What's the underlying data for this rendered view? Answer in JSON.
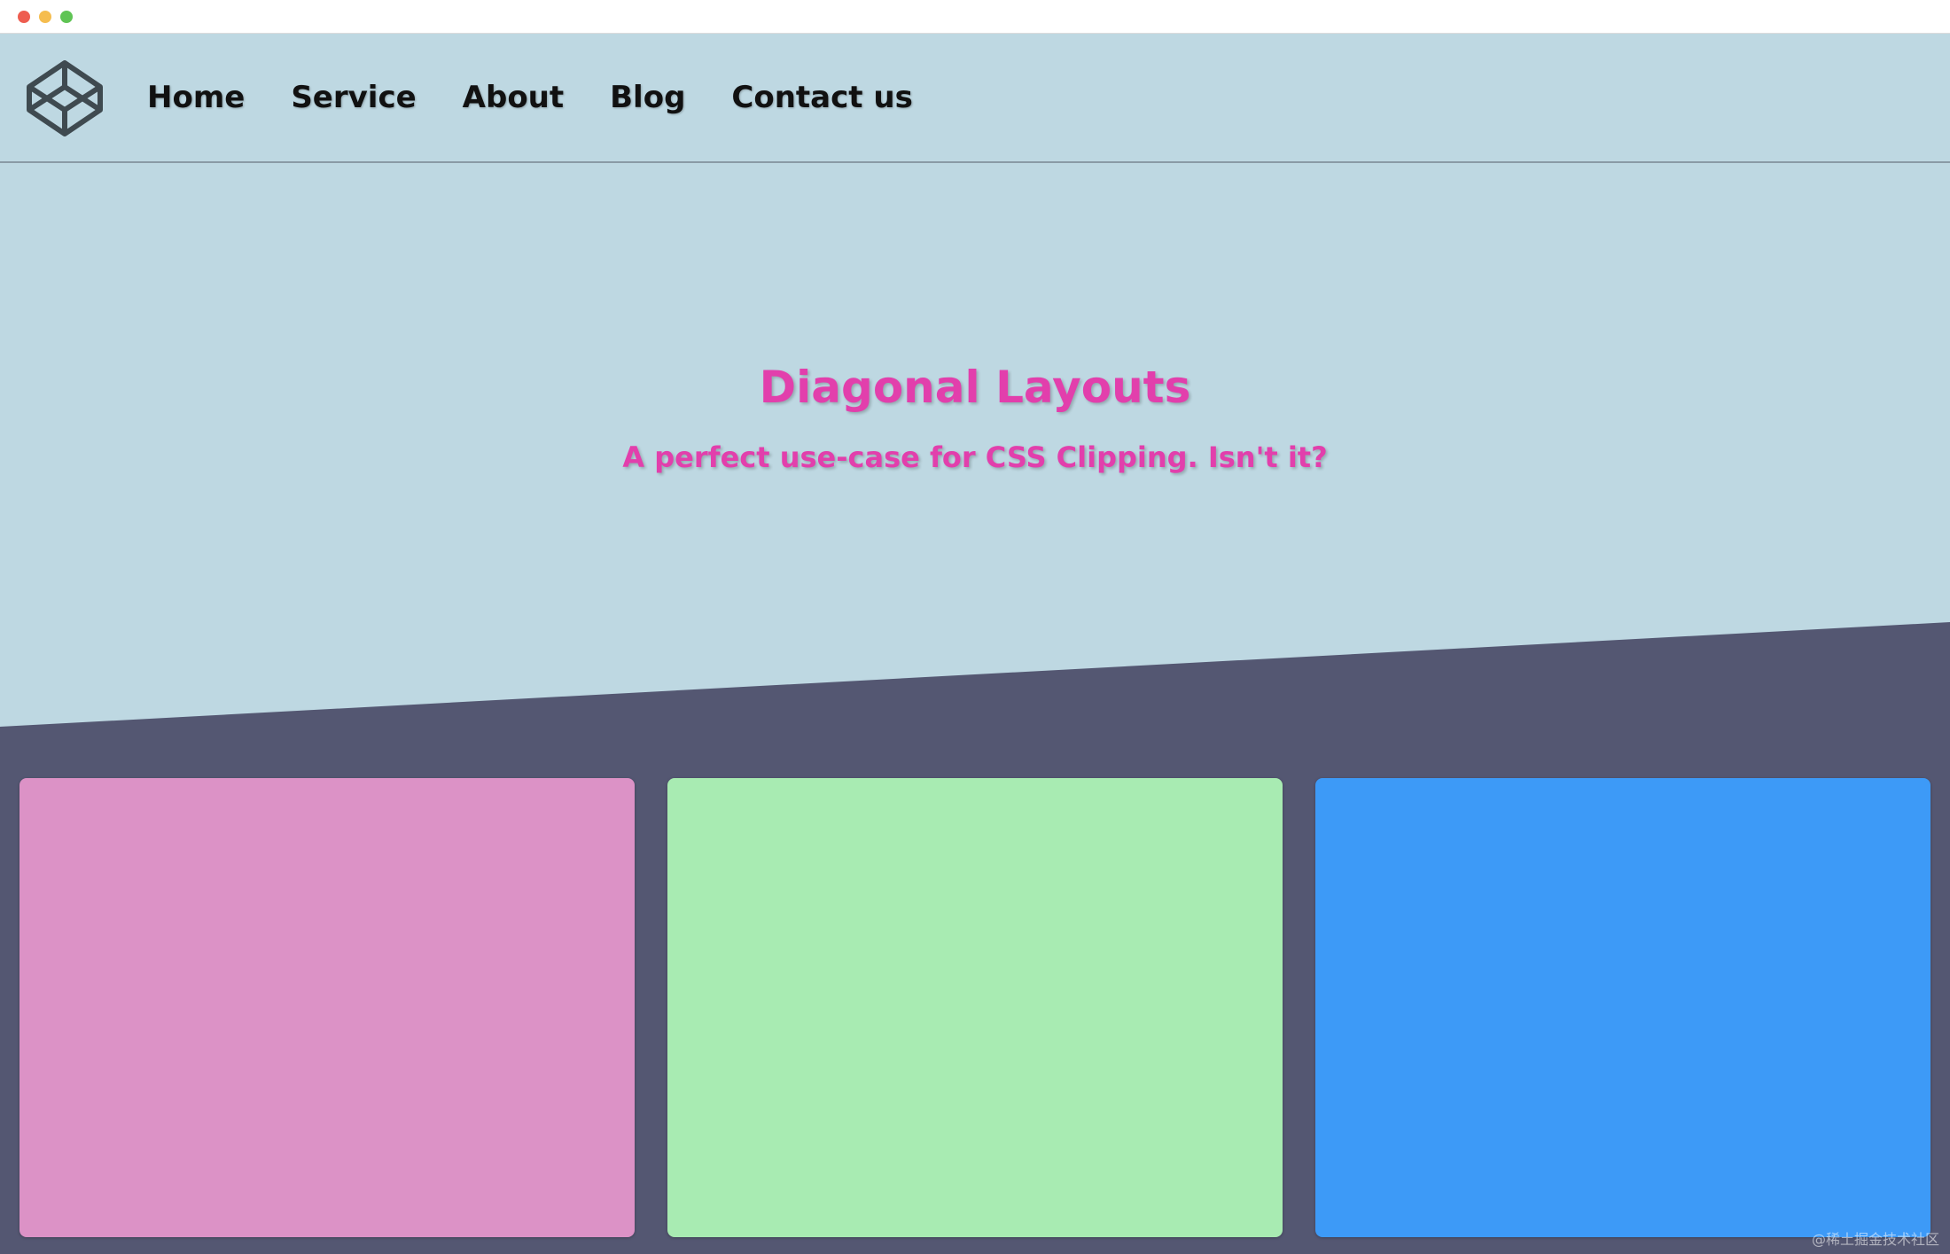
{
  "window": {
    "controls": [
      "close",
      "minimize",
      "maximize"
    ]
  },
  "colors": {
    "titlebar_red": "#ee5d50",
    "titlebar_yellow": "#f5bd4f",
    "titlebar_green": "#5fc454",
    "background": "#bed8e2",
    "diagonal_section": "#545772",
    "accent_text": "#e23fac",
    "card_pink": "#dc92c6",
    "card_green": "#a8ebb2",
    "card_blue": "#3d9af7"
  },
  "nav": {
    "logo_icon": "codepen-icon",
    "links": [
      {
        "label": "Home"
      },
      {
        "label": "Service"
      },
      {
        "label": "About"
      },
      {
        "label": "Blog"
      },
      {
        "label": "Contact us"
      }
    ]
  },
  "hero": {
    "title": "Diagonal Layouts",
    "subtitle": "A perfect use-case for CSS Clipping. Isn't it?"
  },
  "cards": [
    {
      "color": "#dc92c6"
    },
    {
      "color": "#a8ebb2"
    },
    {
      "color": "#3d9af7"
    }
  ],
  "watermark": "@稀土掘金技术社区"
}
